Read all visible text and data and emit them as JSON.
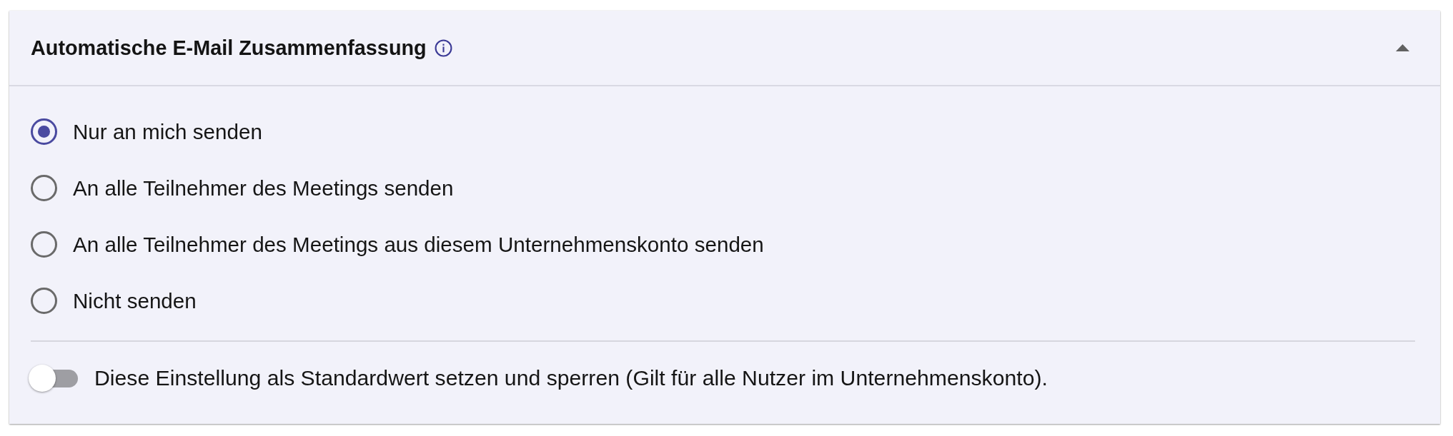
{
  "panel": {
    "title": "Automatische E-Mail Zusammenfassung",
    "expanded": true
  },
  "options": [
    {
      "label": "Nur an mich senden",
      "selected": true
    },
    {
      "label": "An alle Teilnehmer des Meetings senden",
      "selected": false
    },
    {
      "label": "An alle Teilnehmer des Meetings aus diesem Unternehmenskonto senden",
      "selected": false
    },
    {
      "label": "Nicht senden",
      "selected": false
    }
  ],
  "lock_default": {
    "label": "Diese Einstellung als Standardwert setzen und sperren (Gilt für alle Nutzer im Unternehmenskonto).",
    "on": false
  }
}
